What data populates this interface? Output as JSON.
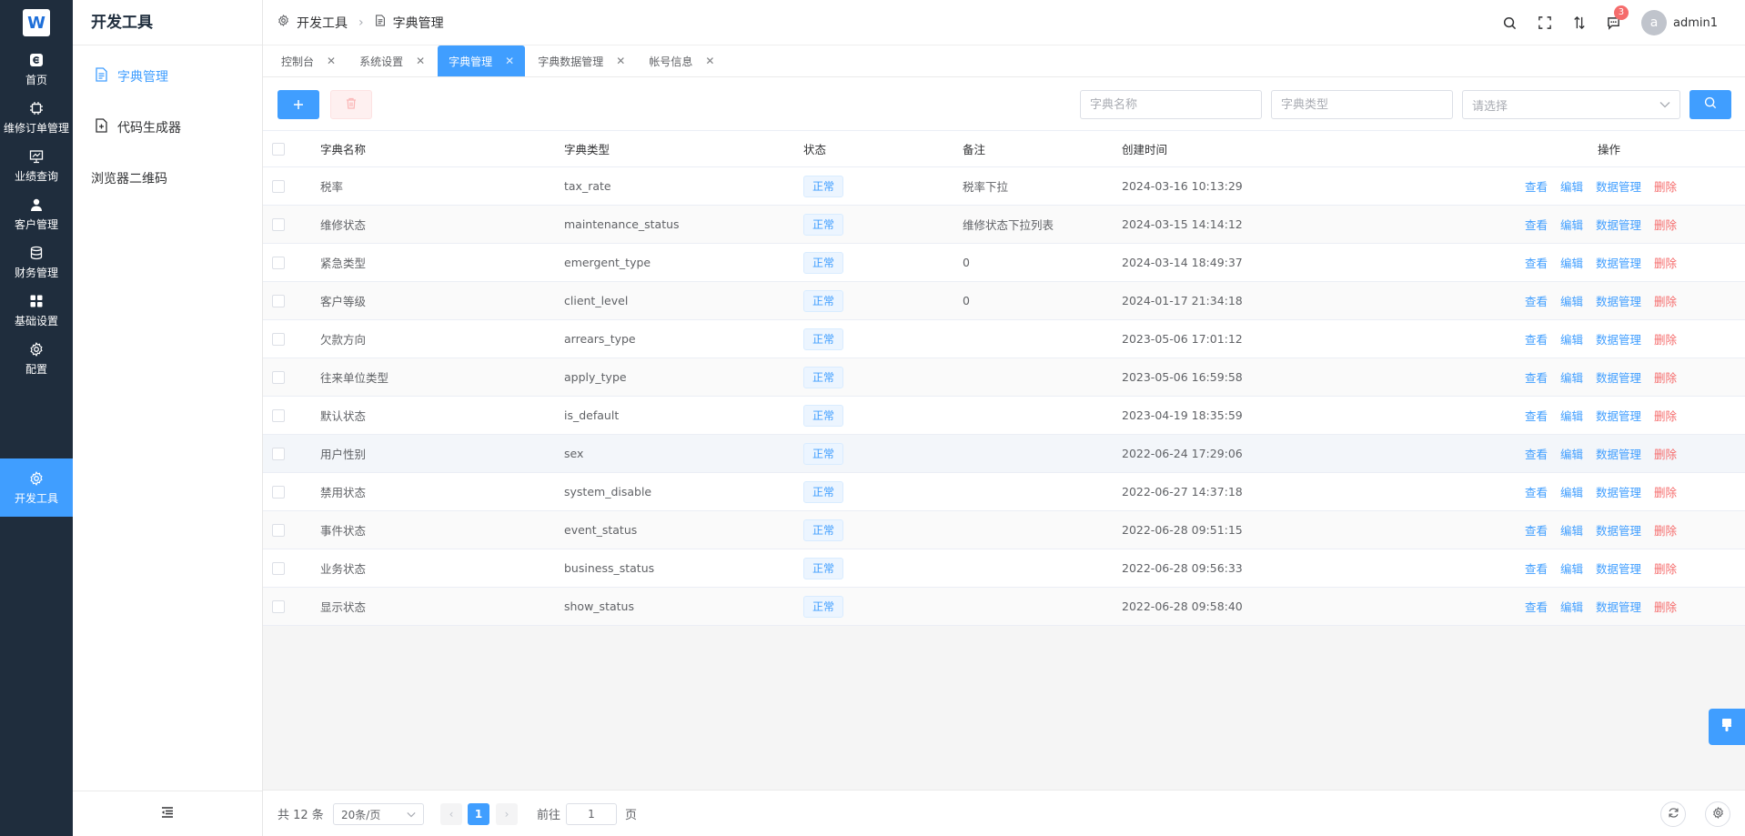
{
  "rail": {
    "items": [
      {
        "label": "首页",
        "icon": "home-icon"
      },
      {
        "label": "维修订单管理",
        "icon": "chip-icon"
      },
      {
        "label": "业绩查询",
        "icon": "chart-board-icon"
      },
      {
        "label": "客户管理",
        "icon": "user-icon"
      },
      {
        "label": "财务管理",
        "icon": "database-icon"
      },
      {
        "label": "基础设置",
        "icon": "grid-icon"
      },
      {
        "label": "配置",
        "icon": "gear-icon"
      },
      {
        "label": "开发工具",
        "icon": "gear-icon"
      }
    ],
    "active_index": 7
  },
  "sidebar": {
    "title": "开发工具",
    "items": [
      {
        "label": "字典管理",
        "icon": "document-icon"
      },
      {
        "label": "代码生成器",
        "icon": "file-plus-icon"
      },
      {
        "label": "浏览器二维码"
      }
    ]
  },
  "header": {
    "breadcrumb": [
      "开发工具",
      "字典管理"
    ],
    "notification_count": "3",
    "avatar_letter": "a",
    "username": "admin1"
  },
  "tabs": [
    {
      "label": "控制台"
    },
    {
      "label": "系统设置"
    },
    {
      "label": "字典管理",
      "active": true
    },
    {
      "label": "字典数据管理"
    },
    {
      "label": "帐号信息"
    }
  ],
  "filters": {
    "name_placeholder": "字典名称",
    "type_placeholder": "字典类型",
    "status_placeholder": "请选择"
  },
  "table": {
    "columns": [
      "字典名称",
      "字典类型",
      "状态",
      "备注",
      "创建时间",
      "操作"
    ],
    "actions": {
      "view": "查看",
      "edit": "编辑",
      "data": "数据管理",
      "delete": "删除"
    },
    "rows": [
      {
        "name": "税率",
        "type": "tax_rate",
        "status": "正常",
        "remark": "税率下拉",
        "created": "2024-03-16 10:13:29"
      },
      {
        "name": "维修状态",
        "type": "maintenance_status",
        "status": "正常",
        "remark": "维修状态下拉列表",
        "created": "2024-03-15 14:14:12"
      },
      {
        "name": "紧急类型",
        "type": "emergent_type",
        "status": "正常",
        "remark": "0",
        "created": "2024-03-14 18:49:37"
      },
      {
        "name": "客户等级",
        "type": "client_level",
        "status": "正常",
        "remark": "0",
        "created": "2024-01-17 21:34:18"
      },
      {
        "name": "欠款方向",
        "type": "arrears_type",
        "status": "正常",
        "remark": "",
        "created": "2023-05-06 17:01:12"
      },
      {
        "name": "往来单位类型",
        "type": "apply_type",
        "status": "正常",
        "remark": "",
        "created": "2023-05-06 16:59:58"
      },
      {
        "name": "默认状态",
        "type": "is_default",
        "status": "正常",
        "remark": "",
        "created": "2023-04-19 18:35:59"
      },
      {
        "name": "用户性别",
        "type": "sex",
        "status": "正常",
        "remark": "",
        "created": "2022-06-24 17:29:06"
      },
      {
        "name": "禁用状态",
        "type": "system_disable",
        "status": "正常",
        "remark": "",
        "created": "2022-06-27 14:37:18"
      },
      {
        "name": "事件状态",
        "type": "event_status",
        "status": "正常",
        "remark": "",
        "created": "2022-06-28 09:51:15"
      },
      {
        "name": "业务状态",
        "type": "business_status",
        "status": "正常",
        "remark": "",
        "created": "2022-06-28 09:56:33"
      },
      {
        "name": "显示状态",
        "type": "show_status",
        "status": "正常",
        "remark": "",
        "created": "2022-06-28 09:58:40"
      }
    ]
  },
  "pagination": {
    "total_label": "共 12 条",
    "page_size": "20条/页",
    "current_page": "1",
    "goto_label": "前往",
    "goto_value": "1",
    "page_suffix": "页"
  },
  "colors": {
    "primary": "#409eff",
    "danger": "#f56c6c",
    "rail_bg": "#1f2d3d"
  }
}
